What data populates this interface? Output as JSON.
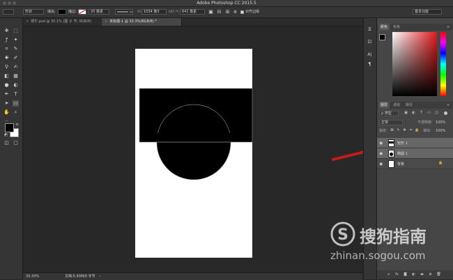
{
  "app": {
    "title": "Adobe Photoshop CC 2015.5"
  },
  "options_bar": {
    "shape_mode": "形状",
    "fill_label": "填充:",
    "stroke_label": "描边:",
    "stroke_size": "20 像素",
    "width_label": "W:",
    "width_value": "1034 像3",
    "link_symbol": "GO",
    "height_label": "H:",
    "height_value": "641 像素",
    "align_edges_label": "对齐边缘",
    "workspace": "基本功能"
  },
  "tabs": [
    {
      "label": "颈牛.psd @ 30.1% (图 子 节, RGB/8)",
      "active": false
    },
    {
      "label": "未标题-1 @ 33.3%(RGB/8) *",
      "active": true
    }
  ],
  "status": {
    "zoom": "33.33%",
    "doc_info": "文档:5.93M/0 字节"
  },
  "panels": {
    "color_tabs": [
      "颜色",
      "色板"
    ],
    "layer_tabs": [
      "图层",
      "通道",
      "路径"
    ],
    "filter_kind": "ρ 类型",
    "blend_mode": "正常",
    "opacity_label": "不透明度:",
    "opacity_value": "100%",
    "lock_label": "锁定:",
    "fill_label": "填充:",
    "fill_value": "100%",
    "layers": [
      {
        "name": "矩形 1",
        "selected": true
      },
      {
        "name": "椭圆 1",
        "selected": true
      },
      {
        "name": "背景",
        "selected": false
      }
    ]
  },
  "mini_panel_icons": [
    "history-icon",
    "adjust-icon",
    "character-icon",
    "paragraph-icon"
  ],
  "watermark": {
    "brand": "搜狗指南",
    "url": "zhinan.sogou.com"
  },
  "colors": {
    "app_bg": "#282828",
    "panel_bg": "#464646",
    "annotation_arrow": "#c01b1b",
    "foreground": "#000000",
    "background": "#ffffff"
  }
}
